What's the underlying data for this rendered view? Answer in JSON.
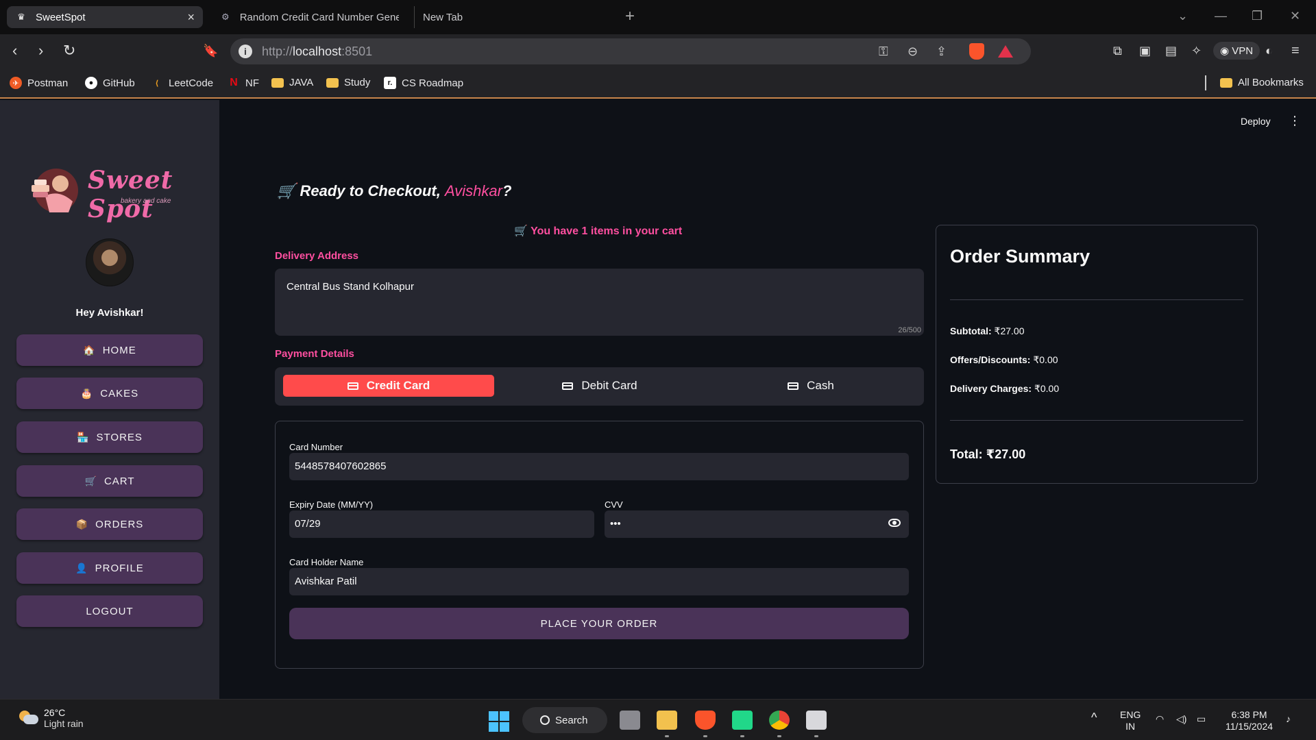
{
  "browser": {
    "tabs": [
      {
        "title": "SweetSpot",
        "active": true
      },
      {
        "title": "Random Credit Card Number Gene",
        "active": false
      },
      {
        "title": "New Tab",
        "active": false
      }
    ],
    "new_tab_symbol": "+",
    "url_scheme": "http://",
    "url_host": "localhost",
    "url_port": ":8501",
    "vpn_label": "VPN",
    "bookmarks": [
      {
        "label": "Postman",
        "icon": "postman-icon"
      },
      {
        "label": "GitHub",
        "icon": "github-icon"
      },
      {
        "label": "LeetCode",
        "icon": "leetcode-icon"
      },
      {
        "label": "NF",
        "icon": "netflix-icon"
      },
      {
        "label": "JAVA",
        "icon": "folder-icon"
      },
      {
        "label": "Study",
        "icon": "folder-icon"
      },
      {
        "label": "CS Roadmap",
        "icon": "roadmap-icon"
      }
    ],
    "all_bookmarks_label": "All Bookmarks"
  },
  "header": {
    "deploy_label": "Deploy",
    "menu_symbol": "⋮"
  },
  "sidebar": {
    "brand": "Sweet Spot",
    "brand_sub": "bakery and cake",
    "greeting": "Hey Avishkar!",
    "items": [
      {
        "emoji": "🏠",
        "label": "HOME"
      },
      {
        "emoji": "🎂",
        "label": "CAKES"
      },
      {
        "emoji": "🏪",
        "label": "STORES"
      },
      {
        "emoji": "🛒",
        "label": "CART"
      },
      {
        "emoji": "📦",
        "label": "ORDERS"
      },
      {
        "emoji": "👤",
        "label": "PROFILE"
      },
      {
        "emoji": "",
        "label": "LOGOUT"
      }
    ]
  },
  "checkout": {
    "heading_prefix": "🛒 Ready to Checkout, ",
    "heading_name": "Avishkar",
    "heading_suffix": "?",
    "cart_message": "🛒 You have 1 items in your cart",
    "address_label": "Delivery Address",
    "address_value": "Central Bus Stand Kolhapur",
    "address_counter": "26/500",
    "payment_label": "Payment Details",
    "payment_tabs": [
      {
        "label": "Credit Card",
        "icon": "credit-card-icon",
        "active": true
      },
      {
        "label": "Debit Card",
        "icon": "debit-card-icon",
        "active": false
      },
      {
        "label": "Cash",
        "icon": "cash-icon",
        "active": false
      }
    ],
    "form": {
      "card_number_label": "Card Number",
      "card_number_value": "5448578407602865",
      "expiry_label": "Expiry Date (MM/YY)",
      "expiry_value": "07/29",
      "cvv_label": "CVV",
      "cvv_value": "•••",
      "holder_label": "Card Holder Name",
      "holder_value": "Avishkar Patil",
      "submit_label": "PLACE YOUR ORDER"
    }
  },
  "order_summary": {
    "title": "Order Summary",
    "subtotal_label": "Subtotal:",
    "subtotal_value": "₹27.00",
    "discount_label": "Offers/Discounts:",
    "discount_value": "₹0.00",
    "delivery_label": "Delivery Charges:",
    "delivery_value": "₹0.00",
    "total_label": "Total:",
    "total_value": "₹27.00"
  },
  "taskbar": {
    "temperature": "26°C",
    "weather": "Light rain",
    "search_label": "Search",
    "lang_top": "ENG",
    "lang_bottom": "IN",
    "time": "6:38 PM",
    "date": "11/15/2024"
  },
  "colors": {
    "accent_pink": "#ff4fa0",
    "button_purple": "#4a3358",
    "active_tab_red": "#ff4b4b",
    "sidebar_bg": "#262730",
    "main_bg": "#0e1117"
  }
}
